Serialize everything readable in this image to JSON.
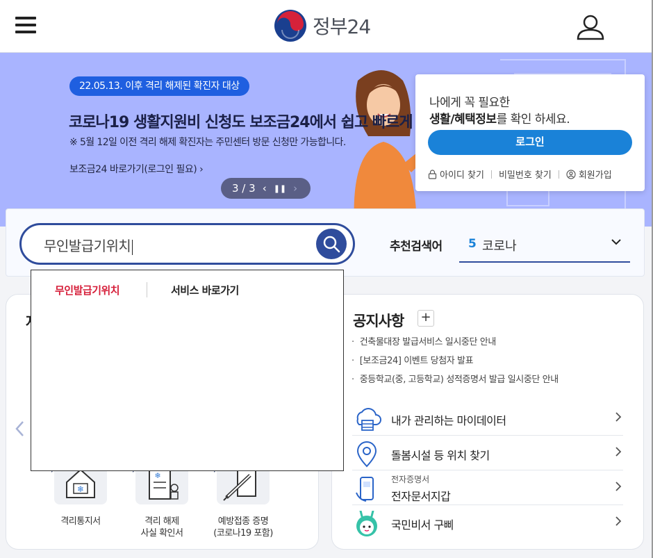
{
  "header": {
    "logo_text": "정부24",
    "menu_icon": "hamburger-menu-icon",
    "user_icon": "user-account-icon"
  },
  "banner": {
    "badge": "22.05.13. 이후 격리 해제된 확진자 대상",
    "title": "코로나19 생활지원비 신청도 보조금24에서 쉽고 빠르게",
    "note": "※ 5월 12일 이전 격리 해제 확진자는 주민센터 방문 신청만 가능합니다.",
    "link": "보조금24 바로가기(로그인 필요) ›",
    "pager": {
      "current": "3",
      "total": "3",
      "label": "3 / 3"
    },
    "background_color": "#a9b4ff"
  },
  "login": {
    "message_line1": "나에게 꼭 필요한",
    "message_bold": "생활/혜택정보",
    "message_rest": "를 확인 하세요.",
    "login_button": "로그인",
    "find_id": "아이디 찾기",
    "find_password": "비밀번호 찾기",
    "signup": "회원가입",
    "accent_color": "#1a82d8"
  },
  "search": {
    "value": "무인발급기위치",
    "recommend_label": "추천검색어",
    "recommend_rank": "5",
    "recommend_keyword": "코로나",
    "accent_color": "#2f4c9c"
  },
  "dropdown": {
    "tab_active": "무인발급기위치",
    "tab_other": "서비스 바로가기"
  },
  "services": [
    {
      "label": "격리통지서",
      "icon": "house-document-icon"
    },
    {
      "label": "격리 해제\n사실 확인서",
      "icon": "document-person-icon"
    },
    {
      "label": "예방접종 증명\n(코로나19 포함)",
      "icon": "syringe-document-icon"
    }
  ],
  "notice": {
    "title": "공지사항",
    "plus": "+",
    "items": [
      "건축물대장 발급서비스 일시중단 안내",
      "[보조금24] 이벤트 당첨자 발표",
      "중등학교(중, 고등학교) 성적증명서 발급 일시중단 안내"
    ]
  },
  "quick_links": [
    {
      "label": "내가 관리하는 마이데이터",
      "icon": "mydata-cloud-icon"
    },
    {
      "label": "돌봄시설 등 위치 찾기",
      "icon": "location-pin-icon"
    },
    {
      "sub": "전자증명서",
      "label": "전자문서지갑",
      "icon": "mobile-wallet-icon"
    },
    {
      "label": "국민비서 구삐",
      "icon": "mascot-gubbi-icon"
    }
  ]
}
